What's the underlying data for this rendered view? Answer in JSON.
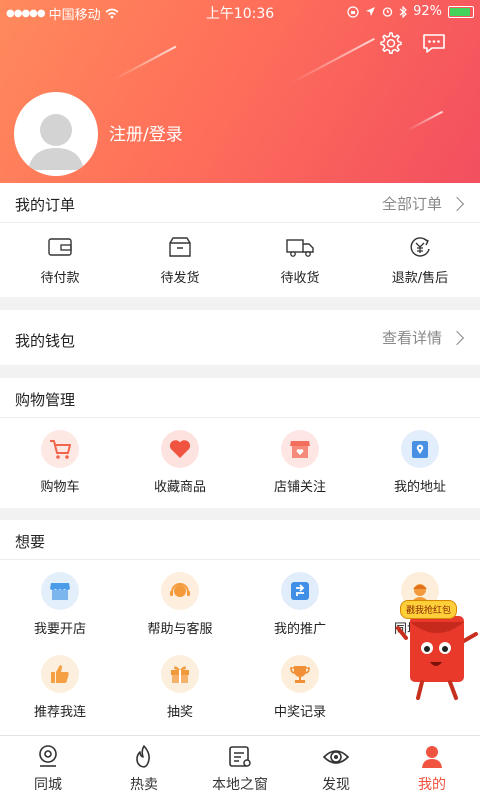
{
  "status_bar": {
    "carrier": "中国移动",
    "time": "上午10:36",
    "battery": "92%",
    "battery_level": 0.92
  },
  "header": {
    "login_label": "注册/登录",
    "settings_icon": "gear-icon",
    "message_icon": "chat-icon"
  },
  "orders": {
    "title": "我的订单",
    "more_label": "全部订单",
    "items": [
      {
        "label": "待付款",
        "icon": "wallet-icon"
      },
      {
        "label": "待发货",
        "icon": "box-icon"
      },
      {
        "label": "待收货",
        "icon": "truck-icon"
      },
      {
        "label": "退款/售后",
        "icon": "refund-yen-icon"
      }
    ]
  },
  "wallet": {
    "title": "我的钱包",
    "more_label": "查看详情"
  },
  "shopping": {
    "title": "购物管理",
    "items": [
      {
        "label": "购物车",
        "icon": "cart-icon",
        "color": "#f0654b"
      },
      {
        "label": "收藏商品",
        "icon": "heart-icon",
        "color": "#f0533f"
      },
      {
        "label": "店铺关注",
        "icon": "store-heart-icon",
        "color": "#f26d5b"
      },
      {
        "label": "我的地址",
        "icon": "location-icon",
        "color": "#4a90e2"
      }
    ]
  },
  "wants": {
    "title": "想要",
    "row1": [
      {
        "label": "我要开店",
        "icon": "shop-icon",
        "color": "#4a9be8"
      },
      {
        "label": "帮助与客服",
        "icon": "headset-icon",
        "color": "#f49a3a"
      },
      {
        "label": "我的推广",
        "icon": "share-icon",
        "color": "#3f8fe6"
      },
      {
        "label": "同城快递",
        "icon": "courier-icon",
        "color": "#f39a3c"
      }
    ],
    "row2": [
      {
        "label": "推荐我连",
        "icon": "thumbs-up-icon",
        "color": "#f5a043"
      },
      {
        "label": "抽奖",
        "icon": "gift-icon",
        "color": "#f29a3b"
      },
      {
        "label": "中奖记录",
        "icon": "trophy-icon",
        "color": "#f08f36"
      }
    ]
  },
  "promo": {
    "tag": "戳我抢红包"
  },
  "tabs": [
    {
      "label": "同城",
      "icon": "location-pin-icon",
      "active": false
    },
    {
      "label": "热卖",
      "icon": "flame-icon",
      "active": false
    },
    {
      "label": "本地之窗",
      "icon": "local-window-icon",
      "active": false
    },
    {
      "label": "发现",
      "icon": "eye-icon",
      "active": false
    },
    {
      "label": "我的",
      "icon": "user-icon",
      "active": true
    }
  ],
  "colors": {
    "accent": "#f0533f",
    "header_gradient_start": "#ff8a5c",
    "header_gradient_end": "#f24f5f"
  }
}
